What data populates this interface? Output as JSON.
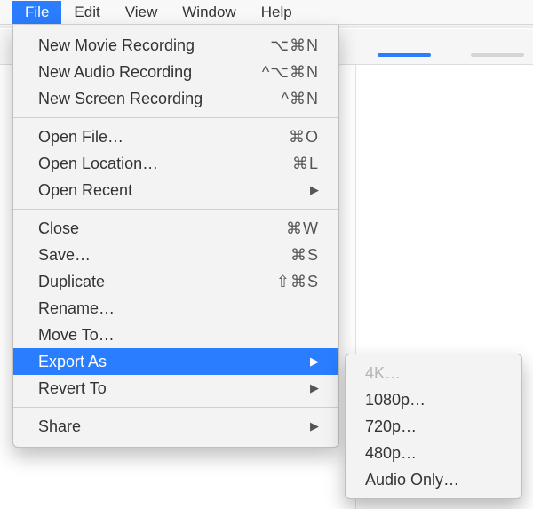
{
  "menubar": {
    "items": [
      {
        "label": "File",
        "active": true
      },
      {
        "label": "Edit"
      },
      {
        "label": "View"
      },
      {
        "label": "Window"
      },
      {
        "label": "Help"
      }
    ]
  },
  "file_menu": {
    "groups": [
      [
        {
          "label": "New Movie Recording",
          "shortcut": "⌥⌘N"
        },
        {
          "label": "New Audio Recording",
          "shortcut": "^⌥⌘N"
        },
        {
          "label": "New Screen Recording",
          "shortcut": "^⌘N"
        }
      ],
      [
        {
          "label": "Open File…",
          "shortcut": "⌘O"
        },
        {
          "label": "Open Location…",
          "shortcut": "⌘L"
        },
        {
          "label": "Open Recent",
          "submenu": true
        }
      ],
      [
        {
          "label": "Close",
          "shortcut": "⌘W"
        },
        {
          "label": "Save…",
          "shortcut": "⌘S"
        },
        {
          "label": "Duplicate",
          "shortcut": "⇧⌘S"
        },
        {
          "label": "Rename…"
        },
        {
          "label": "Move To…"
        },
        {
          "label": "Export As",
          "submenu": true,
          "highlight": true
        },
        {
          "label": "Revert To",
          "submenu": true
        }
      ],
      [
        {
          "label": "Share",
          "submenu": true
        }
      ]
    ]
  },
  "export_submenu": {
    "items": [
      {
        "label": "4K…",
        "disabled": true
      },
      {
        "label": "1080p…"
      },
      {
        "label": "720p…"
      },
      {
        "label": "480p…"
      },
      {
        "label": "Audio Only…"
      }
    ]
  }
}
